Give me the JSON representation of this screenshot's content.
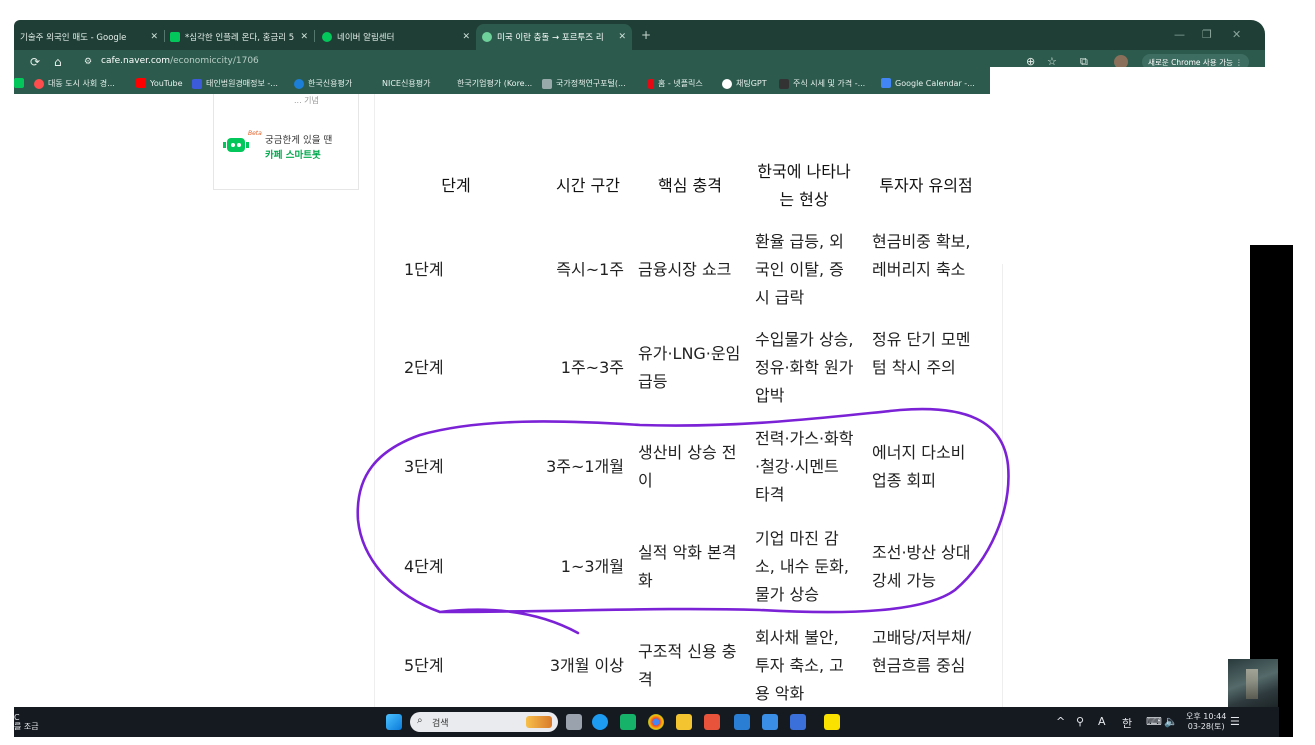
{
  "browser": {
    "tabs": [
      {
        "label": "기술주 외국인 매도 - Google"
      },
      {
        "label": "*심각한 인플레 온다, 홍금리 5"
      },
      {
        "label": "네이버 알림센터"
      },
      {
        "label": "미국 이란 충돌 → 포르투즈 리"
      }
    ],
    "new_tab": "+",
    "url_host": "cafe.naver.com",
    "url_path": "/economiccity/1706",
    "promo": "새로운 Chrome 사용 가능",
    "bookmarks": [
      {
        "label": "대동 도시 사회 경..."
      },
      {
        "label": "YouTube"
      },
      {
        "label": "태인법원경매정보 -..."
      },
      {
        "label": "한국신용평가"
      },
      {
        "label": "NICE신용평가"
      },
      {
        "label": "한국기업평가 (Kore..."
      },
      {
        "label": "국가정책연구포털(..."
      },
      {
        "label": "홈 - 넷플릭스"
      },
      {
        "label": "채팅GPT"
      },
      {
        "label": "주식 시세 및 가격 -..."
      },
      {
        "label": "Google Calendar -..."
      }
    ]
  },
  "sidebar": {
    "cut_text": "... 기념",
    "beta": "Beta",
    "smartbot_line1": "궁금한게 있을 땐",
    "smartbot_line2": "카페 스마트봇"
  },
  "table": {
    "headers": [
      "단계",
      "시간 구간",
      "핵심 충격",
      "한국에 나타나는 현상",
      "투자자 유의점"
    ],
    "rows": [
      {
        "stage": "1단계",
        "period": "즉시~1주",
        "shock": "금융시장 쇼크",
        "korea": "환율 급등, 외국인 이탈, 증시 급락",
        "note": "현금비중 확보, 레버리지 축소"
      },
      {
        "stage": "2단계",
        "period": "1주~3주",
        "shock": "유가·LNG·운임 급등",
        "korea": "수입물가 상승, 정유·화학 원가 압박",
        "note": "정유 단기 모멘텀 착시 주의"
      },
      {
        "stage": "3단계",
        "period": "3주~1개월",
        "shock": "생산비 상승 전이",
        "korea": "전력·가스·화학·철강·시멘트 타격",
        "note": "에너지 다소비 업종 회피"
      },
      {
        "stage": "4단계",
        "period": "1~3개월",
        "shock": "실적 악화 본격화",
        "korea": "기업 마진 감소, 내수 둔화, 물가 상승",
        "note": "조선·방산 상대강세 가능"
      },
      {
        "stage": "5단계",
        "period": "3개월 이상",
        "shock": "구조적 신용 충격",
        "korea": "회사채 불안, 투자 축소, 고용 악화",
        "note": "고배당/저부채/현금흐름 중심"
      }
    ]
  },
  "taskbar": {
    "search_placeholder": "검색",
    "left_text": "C\n를 조금",
    "tray_ime_a": "A",
    "tray_ime_han": "한",
    "clock_line1": "오후 10:44",
    "clock_line2": "03-28(토)"
  },
  "colors": {
    "tab_bar": "#1f3f36",
    "toolbar": "#2c5b4d",
    "annotation": "#7b22d6",
    "naver_green": "#03c75a"
  }
}
